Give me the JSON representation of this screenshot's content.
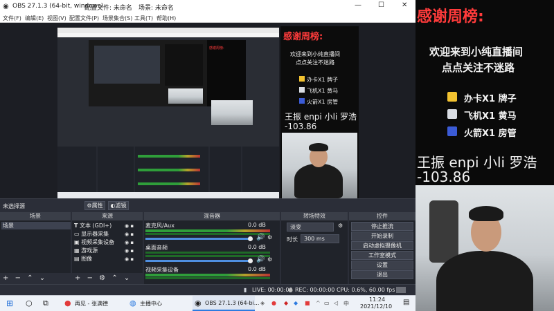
{
  "window": {
    "title": "OBS 27.1.3 (64-bit, windows)",
    "profile": "配置文件: 未命名",
    "scene_collection": "场景: 未命名"
  },
  "menu": [
    "文件(F)",
    "编辑(E)",
    "视图(V)",
    "配置文件(P)",
    "场景集合(S)",
    "工具(T)",
    "帮助(H)"
  ],
  "nested": {
    "thanks_title": "感谢周榜:",
    "welcome": "欢迎来到小纯直播间",
    "follow": "点点关注不迷路",
    "names": "王振 enpi 小li 罗浩",
    "score": "-103.86",
    "rank": [
      {
        "label": "办卡X1 牌子"
      },
      {
        "label": "飞机X1 黄马"
      },
      {
        "label": "火箭X1 房管"
      }
    ]
  },
  "no_source_selected": "未选择源",
  "properties_button": "属性",
  "filters_button": "滤镜",
  "docks": {
    "scenes": {
      "title": "场景",
      "items": [
        "场景"
      ]
    },
    "sources": {
      "title": "来源",
      "items": [
        "文本 (GDI+)",
        "显示器采集",
        "视频采集设备",
        "游戏源",
        "图像"
      ]
    },
    "mixer": {
      "title": "混音器",
      "channels": [
        {
          "name": "麦克风/Aux",
          "db": "0.0 dB"
        },
        {
          "name": "桌面音频",
          "db": "0.0 dB"
        },
        {
          "name": "视频采集设备",
          "db": "0.0 dB"
        }
      ]
    },
    "transitions": {
      "title": "转场特效",
      "type": "淡变",
      "duration_label": "时长",
      "duration_value": "300 ms"
    },
    "controls": {
      "title": "控件",
      "buttons": [
        "停止推流",
        "开始录制",
        "启动虚拟摄像机",
        "工作室模式",
        "设置",
        "退出"
      ]
    }
  },
  "statusbar": {
    "live": "LIVE: 00:00:00",
    "rec": "REC: 00:00:00",
    "cpu": "CPU: 0.6%, 60.00 fps"
  },
  "taskbar": {
    "items": [
      "再见 - 张满德",
      "主播中心",
      "OBS 27.1.3 (64-bi..."
    ],
    "time": "11:24",
    "date": "2021/12/10"
  },
  "overlay": {
    "thanks_title": "感谢周榜:",
    "welcome": "欢迎来到小纯直播间",
    "follow": "点点关注不迷路",
    "rank": [
      {
        "label": "办卡X1 牌子",
        "icon": "card-icon",
        "color": "#f2c230"
      },
      {
        "label": "飞机X1 黄马",
        "icon": "airplane-icon",
        "color": "#d9dde3"
      },
      {
        "label": "火箭X1 房管",
        "icon": "rocket-icon",
        "color": "#3b5bd6"
      }
    ],
    "names": "王振 enpi 小li 罗浩",
    "score": "-103.86"
  },
  "colors": {
    "accent_red": "#ff3b3b",
    "meter_green": "#2f9e3a",
    "slider_blue": "#4f8fe0"
  }
}
